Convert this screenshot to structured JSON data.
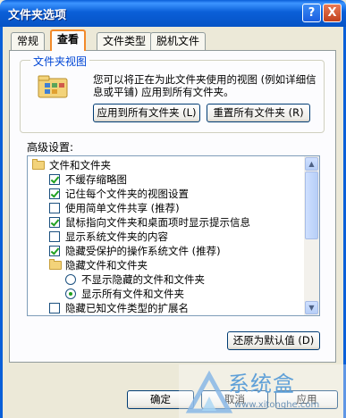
{
  "window": {
    "title": "文件夹选项"
  },
  "titlebar_buttons": {
    "help": "?",
    "close": "X"
  },
  "tabs": [
    {
      "label": "常规"
    },
    {
      "label": "查看"
    },
    {
      "label": "文件类型"
    },
    {
      "label": "脱机文件"
    }
  ],
  "folder_views": {
    "title": "文件夹视图",
    "description": "您可以将正在为此文件夹使用的视图 (例如详细信息或平铺) 应用到所有文件夹。",
    "apply_all_label": "应用到所有文件夹 (L)",
    "reset_all_label": "重置所有文件夹 (R)"
  },
  "advanced": {
    "label": "高级设置:",
    "items": [
      {
        "type": "folder",
        "text": "文件和文件夹"
      },
      {
        "type": "checkbox",
        "checked": true,
        "text": "不缓存缩略图"
      },
      {
        "type": "checkbox",
        "checked": true,
        "text": "记住每个文件夹的视图设置"
      },
      {
        "type": "checkbox",
        "checked": false,
        "text": "使用简单文件共享 (推荐)"
      },
      {
        "type": "checkbox",
        "checked": true,
        "text": "鼠标指向文件夹和桌面项时显示提示信息"
      },
      {
        "type": "checkbox",
        "checked": false,
        "text": "显示系统文件夹的内容"
      },
      {
        "type": "checkbox",
        "checked": true,
        "text": "隐藏受保护的操作系统文件 (推荐)"
      },
      {
        "type": "folder",
        "text": "隐藏文件和文件夹"
      },
      {
        "type": "radio",
        "checked": false,
        "text": "不显示隐藏的文件和文件夹"
      },
      {
        "type": "radio",
        "checked": true,
        "text": "显示所有文件和文件夹"
      },
      {
        "type": "checkbox",
        "checked": false,
        "text": "隐藏已知文件类型的扩展名"
      }
    ],
    "restore_defaults_label": "还原为默认值 (D)"
  },
  "footer": {
    "ok_label": "确定",
    "cancel_label": "取消",
    "apply_label": "应用"
  },
  "watermark": {
    "text": "系统盒",
    "url": "www.xitonghe.com"
  },
  "colors": {
    "title_bar": "#0a5fd8",
    "active_tab_border": "#f28a2b",
    "check_mark": "#21a121",
    "group_title": "#0046d5"
  }
}
